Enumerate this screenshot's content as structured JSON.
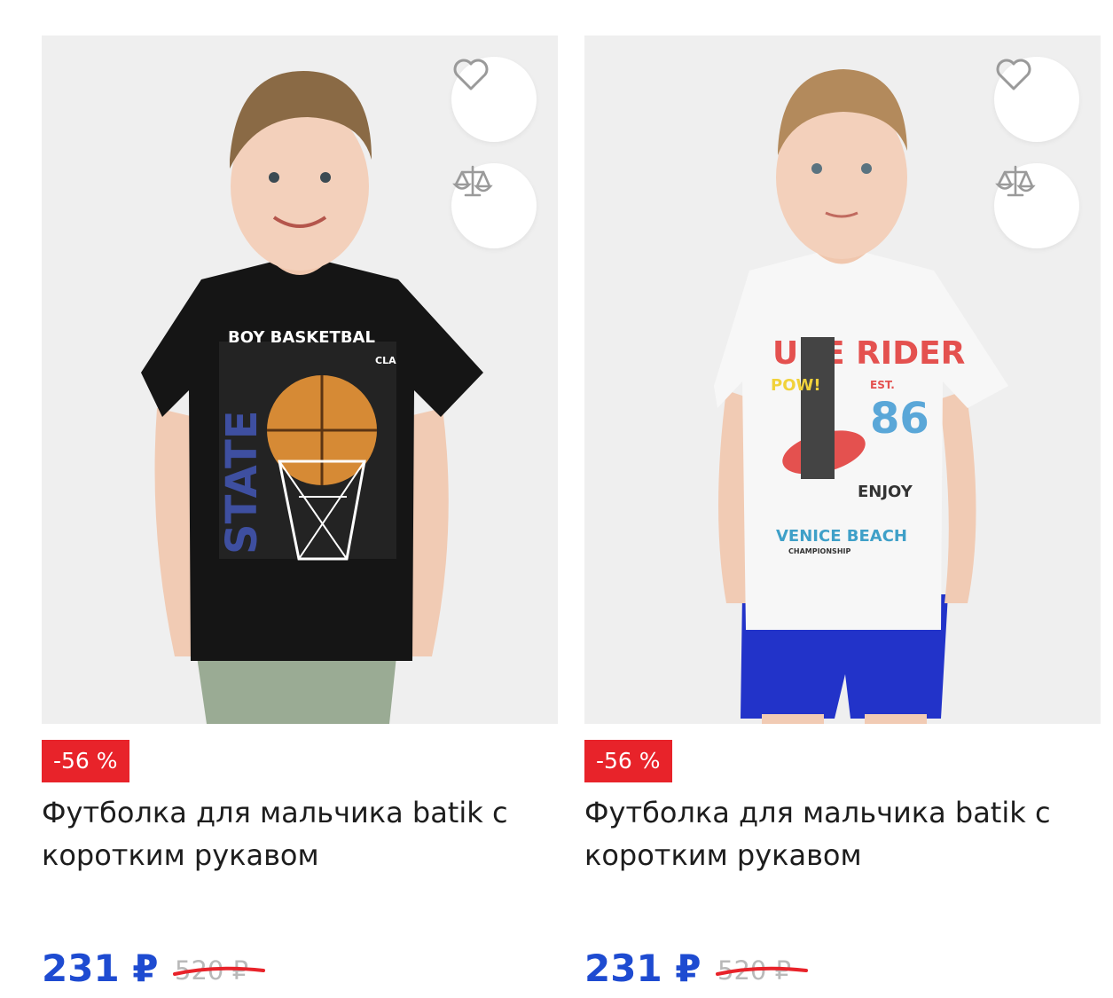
{
  "products": [
    {
      "discount": "-56 %",
      "title": "Футболка для мальчика batik с коротким рукавом",
      "price": "231 ₽",
      "old_price": "520 ₽",
      "photo": {
        "print_line1": "BOY BASKETBAL",
        "print_line2": "CLA",
        "print_vertical": "STATE"
      }
    },
    {
      "discount": "-56 %",
      "title": "Футболка для мальчика batik с коротким рукавом",
      "price": "231 ₽",
      "old_price": "520 ₽",
      "photo": {
        "print_top": "URE RIDER",
        "print_pow": "POW!",
        "print_est": "EST.",
        "print_num": "86",
        "print_enjoy": "ENJOY",
        "print_beach": "VENICE BEACH",
        "print_champ": "CHAMPIONSHIP"
      }
    }
  ],
  "icons": {
    "favorite": "heart-icon",
    "compare": "scales-icon"
  },
  "colors": {
    "price": "#1e4bd1",
    "discount_bg": "#e8232a",
    "strike": "#e8232a"
  }
}
